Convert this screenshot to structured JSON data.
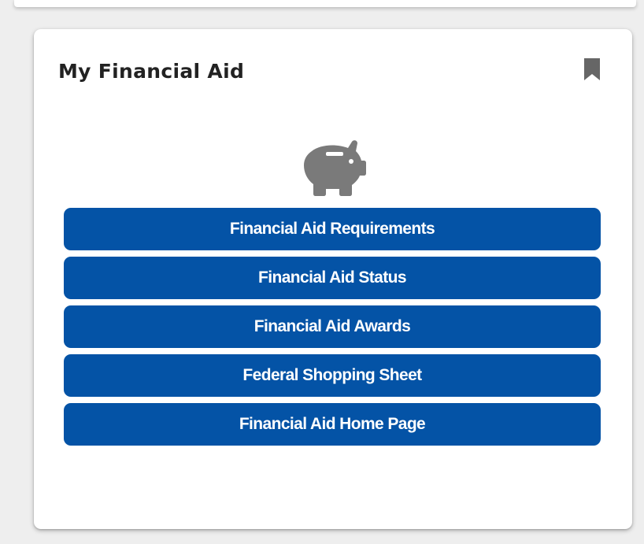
{
  "card": {
    "title": "My Financial Aid",
    "bookmark_icon": "bookmark-icon",
    "hero_icon": "piggy-bank-icon"
  },
  "links": [
    {
      "label": "Financial Aid Requirements"
    },
    {
      "label": "Financial Aid Status"
    },
    {
      "label": "Financial Aid Awards"
    },
    {
      "label": "Federal Shopping Sheet"
    },
    {
      "label": "Financial Aid Home Page"
    }
  ],
  "colors": {
    "button_bg": "#0453a6",
    "button_text": "#ffffff",
    "icon_gray": "#7a7a7a",
    "title_text": "#222222"
  }
}
